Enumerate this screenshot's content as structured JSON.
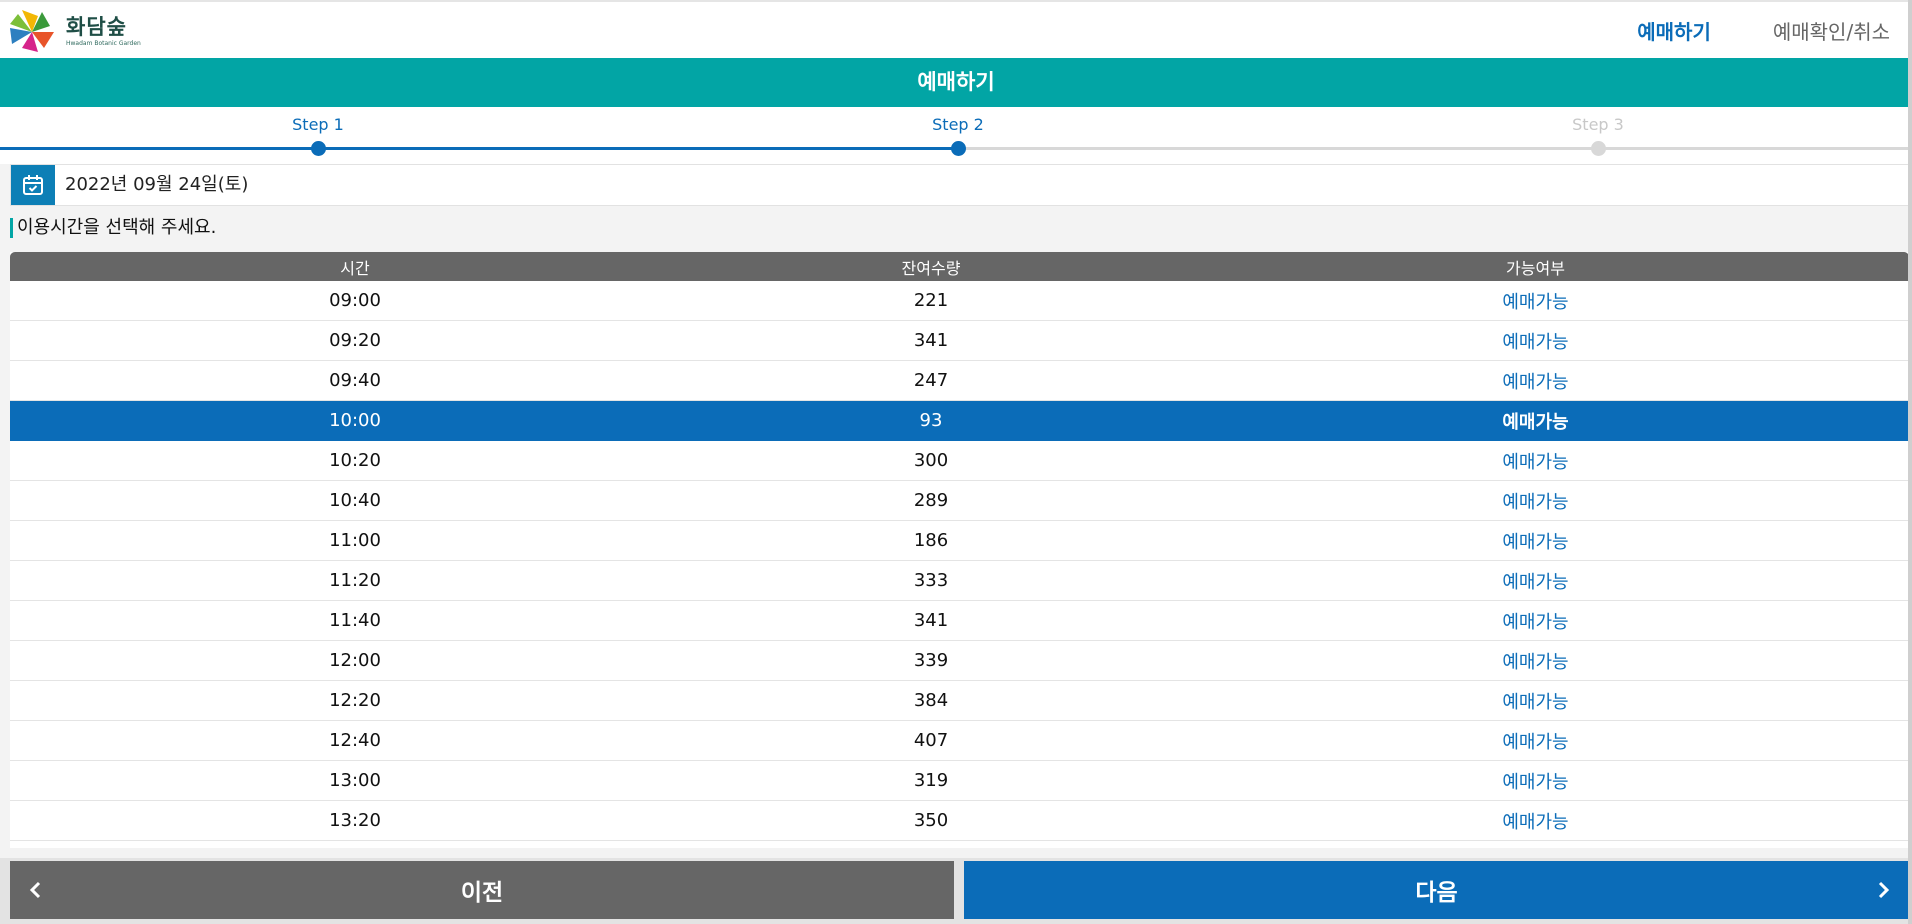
{
  "header": {
    "logo_title": "화담숲",
    "logo_sub": "Hwadam Botanic Garden",
    "nav": [
      {
        "label": "예매하기",
        "active": true
      },
      {
        "label": "예매확인/취소",
        "active": false
      }
    ]
  },
  "title_bar": {
    "label": "예매하기"
  },
  "steps": [
    {
      "label": "Step 1",
      "state": "done"
    },
    {
      "label": "Step 2",
      "state": "done"
    },
    {
      "label": "Step 3",
      "state": "todo"
    }
  ],
  "date": {
    "icon": "calendar-check-icon",
    "value": "2022년 09월 24일(토)"
  },
  "instruction": "이용시간을 선택해 주세요.",
  "table": {
    "headers": [
      "시간",
      "잔여수량",
      "가능여부"
    ],
    "selected_index": 3,
    "rows": [
      {
        "time": "09:00",
        "remaining": "221",
        "status": "예매가능"
      },
      {
        "time": "09:20",
        "remaining": "341",
        "status": "예매가능"
      },
      {
        "time": "09:40",
        "remaining": "247",
        "status": "예매가능"
      },
      {
        "time": "10:00",
        "remaining": "93",
        "status": "예매가능"
      },
      {
        "time": "10:20",
        "remaining": "300",
        "status": "예매가능"
      },
      {
        "time": "10:40",
        "remaining": "289",
        "status": "예매가능"
      },
      {
        "time": "11:00",
        "remaining": "186",
        "status": "예매가능"
      },
      {
        "time": "11:20",
        "remaining": "333",
        "status": "예매가능"
      },
      {
        "time": "11:40",
        "remaining": "341",
        "status": "예매가능"
      },
      {
        "time": "12:00",
        "remaining": "339",
        "status": "예매가능"
      },
      {
        "time": "12:20",
        "remaining": "384",
        "status": "예매가능"
      },
      {
        "time": "12:40",
        "remaining": "407",
        "status": "예매가능"
      },
      {
        "time": "13:00",
        "remaining": "319",
        "status": "예매가능"
      },
      {
        "time": "13:20",
        "remaining": "350",
        "status": "예매가능"
      }
    ]
  },
  "buttons": {
    "prev": "이전",
    "next": "다음"
  },
  "colors": {
    "primary": "#0b6cb8",
    "teal": "#02a5a5",
    "grey": "#666666"
  }
}
